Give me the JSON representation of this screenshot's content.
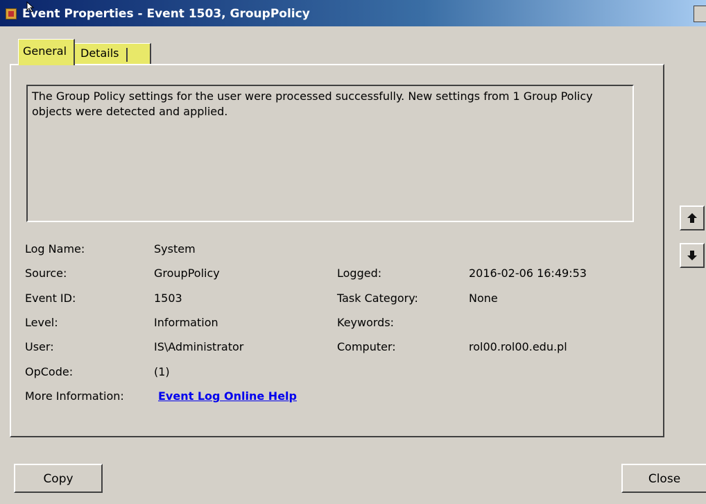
{
  "window": {
    "title": "Event Properties - Event 1503, GroupPolicy"
  },
  "tabs": [
    {
      "label": "General"
    },
    {
      "label": "Details"
    }
  ],
  "description": "The Group Policy settings for the user were processed successfully. New settings from 1 Group Policy objects were detected and applied.",
  "fields": {
    "log_name": {
      "label": "Log Name:",
      "value": "System"
    },
    "source": {
      "label": "Source:",
      "value": "GroupPolicy"
    },
    "logged": {
      "label": "Logged:",
      "value": "2016-02-06 16:49:53"
    },
    "event_id": {
      "label": "Event ID:",
      "value": "1503"
    },
    "task_category": {
      "label": "Task Category:",
      "value": "None"
    },
    "level": {
      "label": "Level:",
      "value": "Information"
    },
    "keywords": {
      "label": "Keywords:",
      "value": ""
    },
    "user": {
      "label": "User:",
      "value": "IS\\Administrator"
    },
    "computer": {
      "label": "Computer:",
      "value": "rol00.rol00.edu.pl"
    },
    "opcode": {
      "label": "OpCode:",
      "value": "(1)"
    },
    "more_info": {
      "label": "More Information:",
      "link": "Event Log Online Help"
    }
  },
  "buttons": {
    "copy": "Copy",
    "close": "Close"
  },
  "icons": {
    "nav_up": "arrow-up-icon",
    "nav_down": "arrow-down-icon",
    "title": "event-viewer-icon"
  },
  "colors": {
    "highlight": "#e8e869",
    "link": "#0000ee"
  }
}
